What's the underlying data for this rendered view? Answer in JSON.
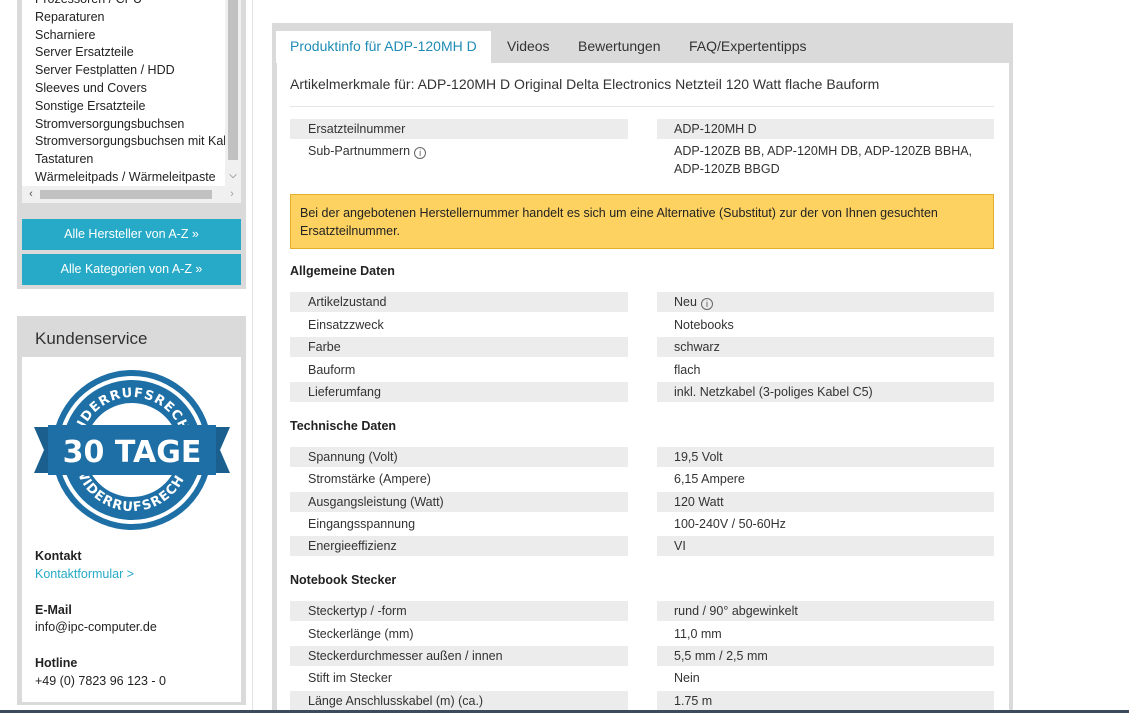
{
  "sidebar": {
    "categories": [
      "Prozessoren / CPU",
      "Reparaturen",
      "Scharniere",
      "Server Ersatzteile",
      "Server Festplatten / HDD",
      "Sleeves und Covers",
      "Sonstige Ersatzteile",
      "Stromversorgungsbuchsen",
      "Stromversorgungsbuchsen mit Kabel",
      "Tastaturen",
      "Wärmeleitpads / Wärmeleitpaste"
    ],
    "btn_manufacturers": "Alle Hersteller von A-Z »",
    "btn_categories": "Alle Kategorien von A-Z »"
  },
  "service": {
    "title": "Kundenservice",
    "seal_top_text": "WIDERRUFSRECHT",
    "seal_ribbon_text": "30 TAGE",
    "seal_bottom_text": "WIDERRUFSRECHT",
    "contact_label": "Kontakt",
    "contact_link": "Kontaktformular >",
    "email_label": "E-Mail",
    "email_value": "info@ipc-computer.de",
    "hotline_label": "Hotline",
    "hotline_value": "+49 (0) 7823 96 123 - 0"
  },
  "tabs": [
    {
      "label": "Produktinfo für ADP-120MH D"
    },
    {
      "label": "Videos"
    },
    {
      "label": "Bewertungen"
    },
    {
      "label": "FAQ/Expertentipps"
    }
  ],
  "product": {
    "title": "Artikelmerkmale für: ADP-120MH D Original Delta Electronics Netzteil 120 Watt flache Bauform",
    "part_number_label": "Ersatzteilnummer",
    "part_number": "ADP-120MH D",
    "sub_parts_label": "Sub-Partnummern",
    "sub_parts": "ADP-120ZB BB, ADP-120MH DB, ADP-120ZB BBHA, ADP-120ZB BBGD",
    "notice": "Bei der angebotenen Herstellernummer handelt es sich um eine Alternative (Substitut) zur der von Ihnen gesuchten Ersatzteilnummer."
  },
  "sections": {
    "general": {
      "title": "Allgemeine Daten",
      "rows": [
        {
          "k": "Artikelzustand",
          "v": "Neu"
        },
        {
          "k": "Einsatzzweck",
          "v": "Notebooks"
        },
        {
          "k": "Farbe",
          "v": "schwarz"
        },
        {
          "k": "Bauform",
          "v": "flach"
        },
        {
          "k": "Lieferumfang",
          "v": "inkl. Netzkabel (3-poliges Kabel C5)"
        }
      ]
    },
    "technical": {
      "title": "Technische Daten",
      "rows": [
        {
          "k": "Spannung (Volt)",
          "v": "19,5 Volt"
        },
        {
          "k": "Stromstärke (Ampere)",
          "v": "6,15 Ampere"
        },
        {
          "k": "Ausgangsleistung (Watt)",
          "v": "120 Watt"
        },
        {
          "k": "Eingangsspannung",
          "v": "100-240V / 50-60Hz"
        },
        {
          "k": "Energieeffizienz",
          "v": "VI"
        }
      ]
    },
    "plug": {
      "title": "Notebook Stecker",
      "rows": [
        {
          "k": "Steckertyp / -form",
          "v": "rund / 90° abgewinkelt"
        },
        {
          "k": "Steckerlänge (mm)",
          "v": "11,0 mm"
        },
        {
          "k": "Steckerdurchmesser außen / innen",
          "v": "5,5 mm / 2,5 mm"
        },
        {
          "k": "Stift im Stecker",
          "v": "Nein"
        },
        {
          "k": "Länge Anschlusskabel (m) (ca.)",
          "v": "1.75 m"
        }
      ]
    }
  },
  "colors": {
    "accent": "#26aac7",
    "tab_active": "#1f8cb5",
    "notice_bg": "#fdd260",
    "seal_blue": "#1d6fa5"
  }
}
